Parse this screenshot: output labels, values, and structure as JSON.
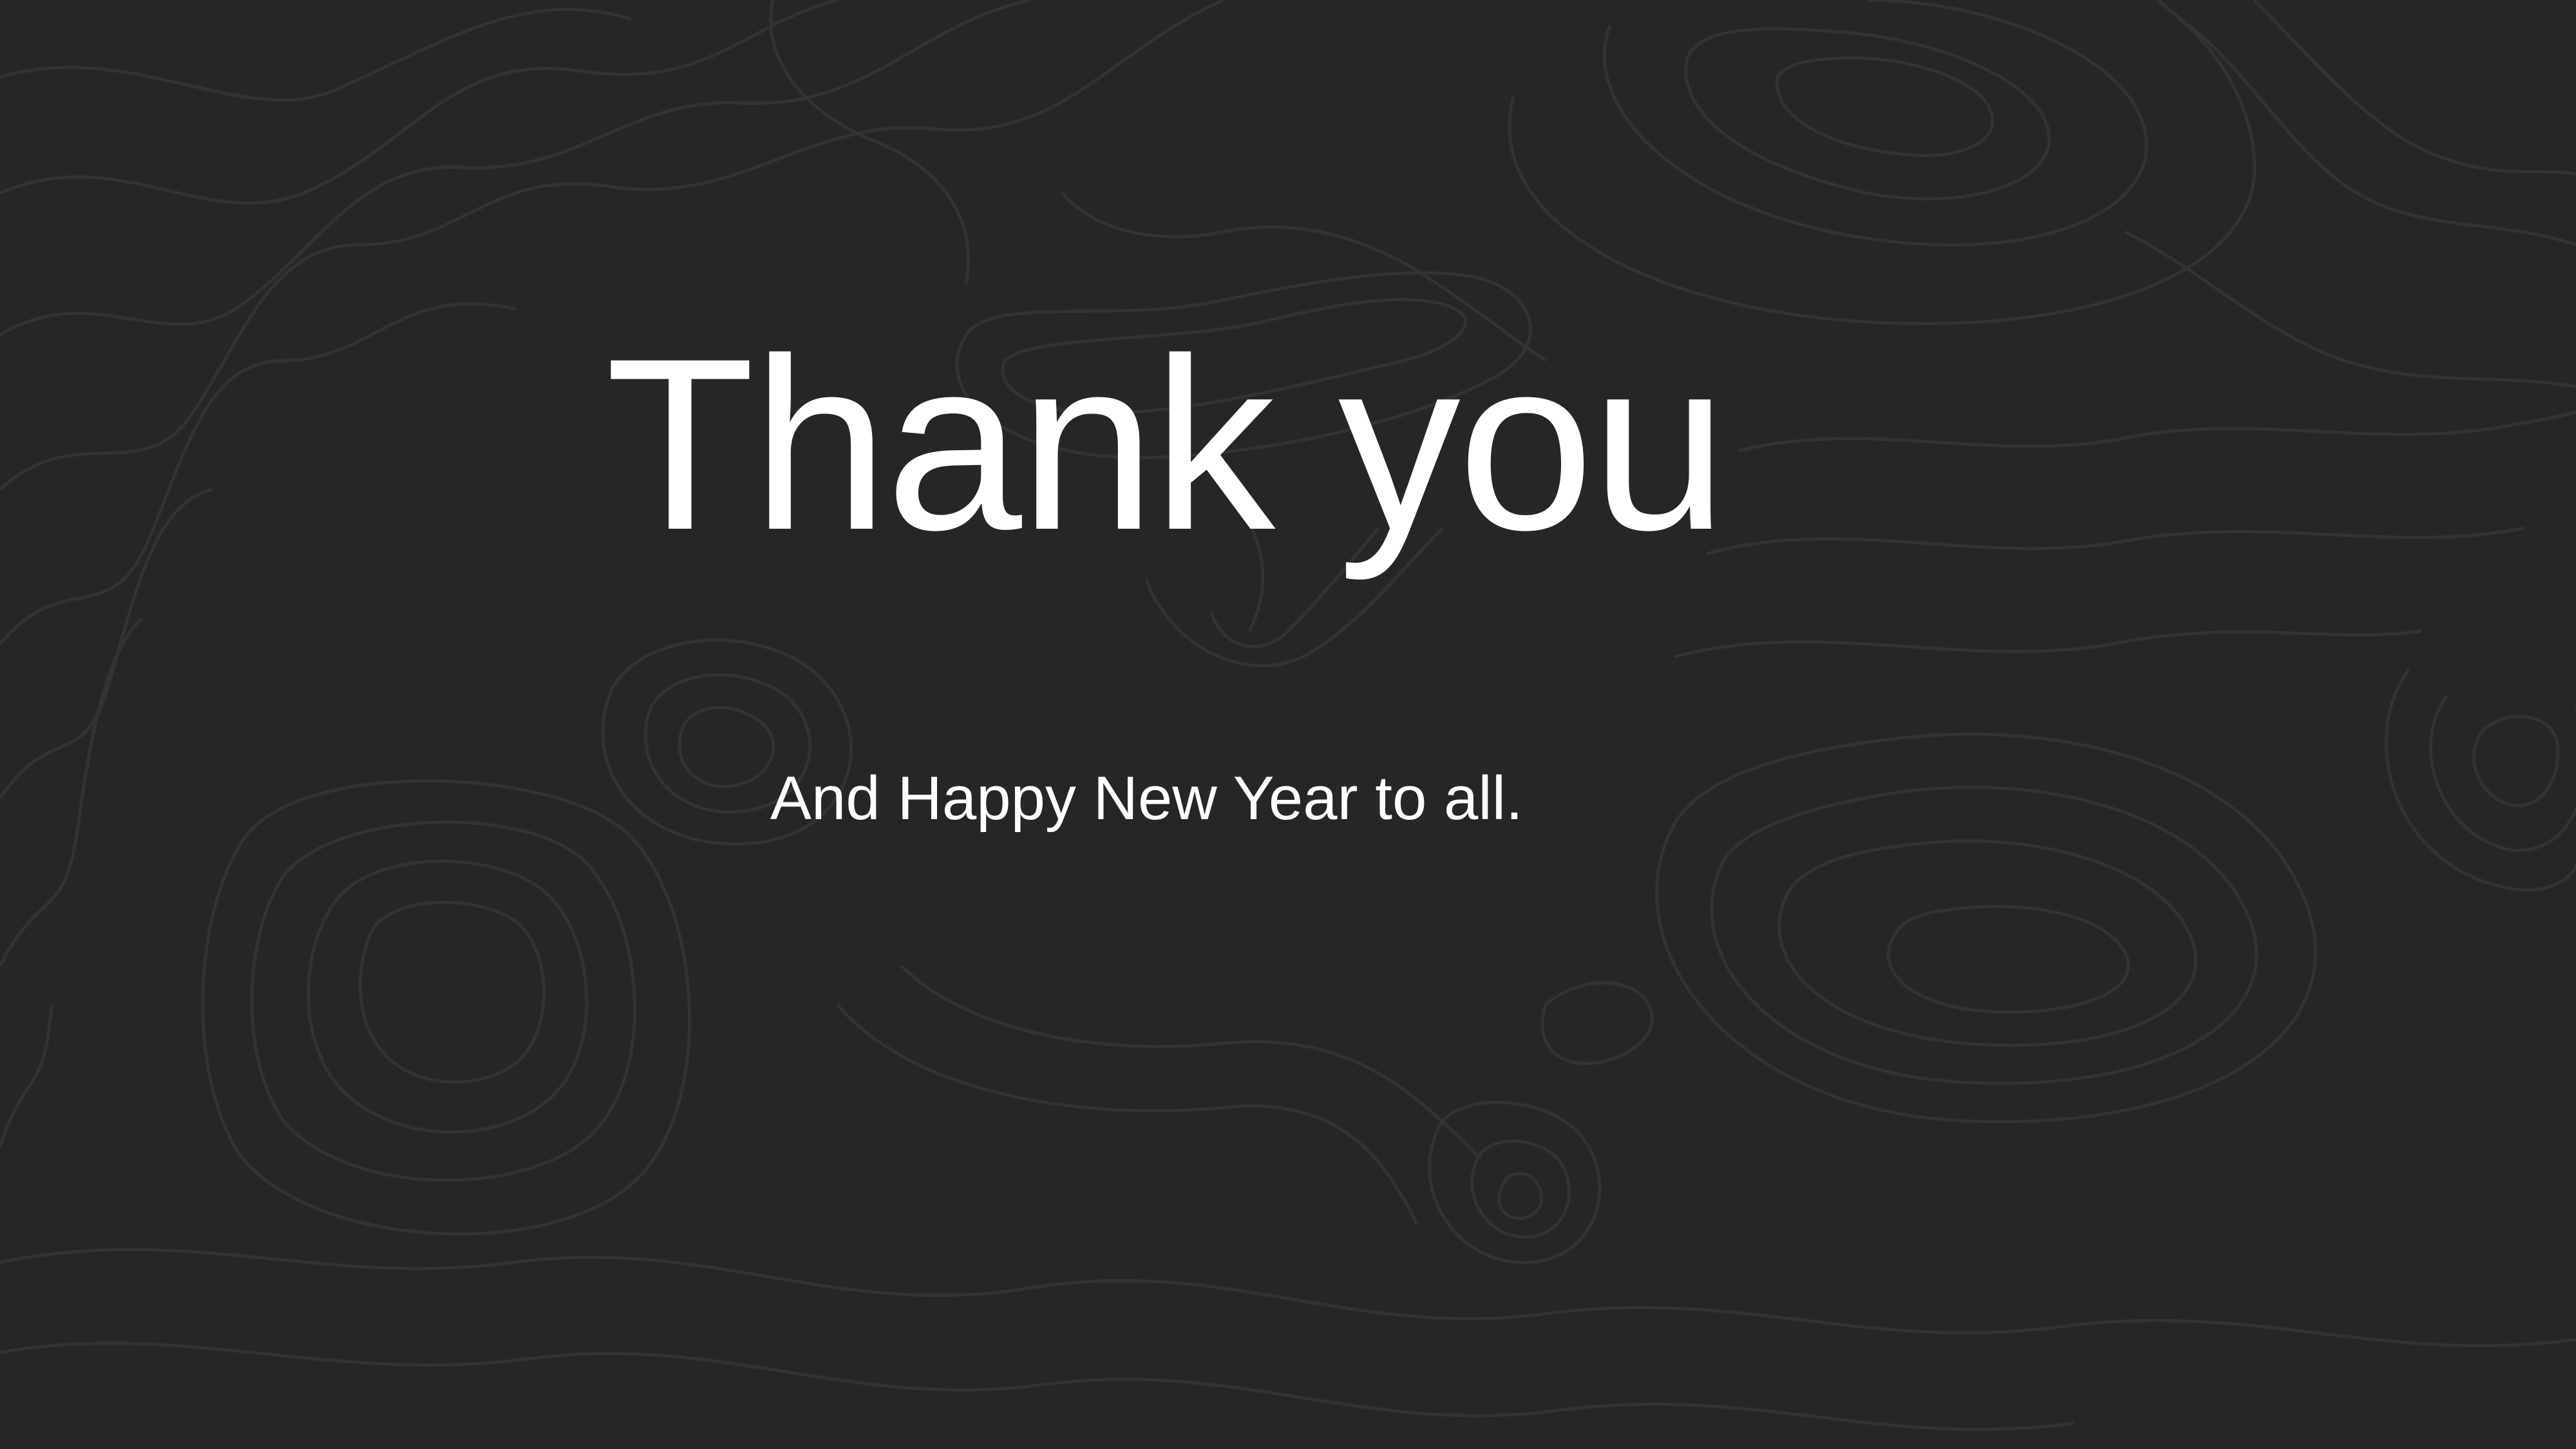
{
  "slide": {
    "title": "Thank you",
    "subtitle": "And Happy New Year to all."
  },
  "colors": {
    "background": "#262626",
    "contour_lines": "#333333",
    "text": "#ffffff"
  }
}
